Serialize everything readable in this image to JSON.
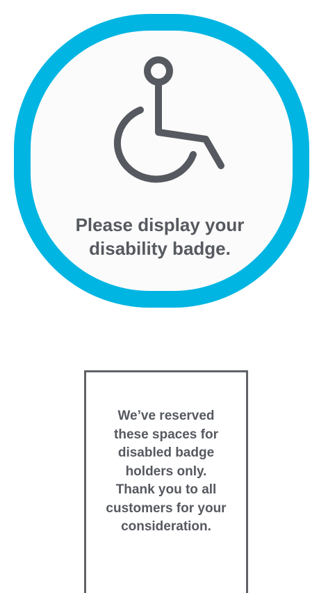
{
  "badge_sign": {
    "icon": "wheelchair-icon",
    "border_color": "#00b5e2",
    "text": "Please display your disability badge."
  },
  "notice": {
    "text": "We’ve reserved\nthese spaces for\ndisabled badge\nholders only.\nThank you to all\ncustomers for your\nconsideration."
  }
}
